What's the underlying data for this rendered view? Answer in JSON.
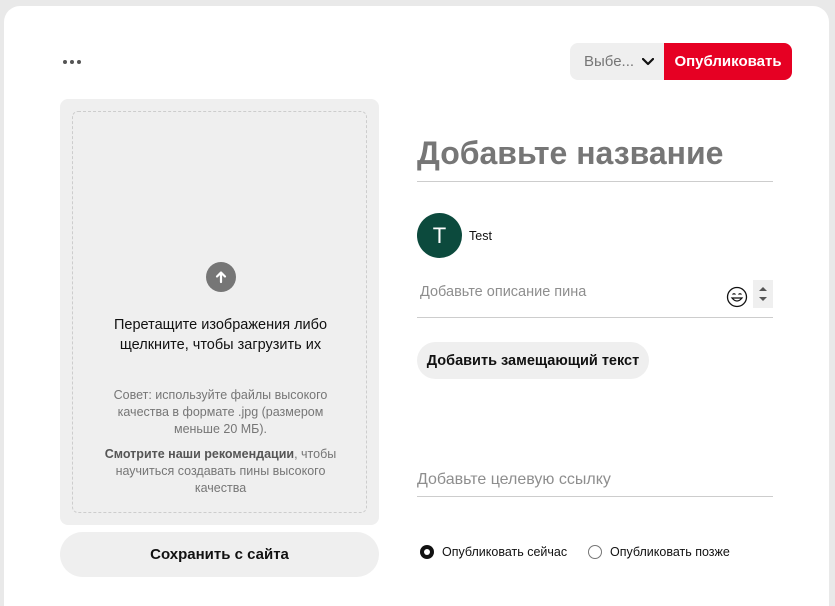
{
  "toolbar": {
    "board_select_label": "Выбе...",
    "publish_label": "Опубликовать"
  },
  "upload": {
    "title": "Перетащите изображения либо щелкните, чтобы загрузить их",
    "tip": "Совет: используйте файлы высокого качества в формате .jpg (размером меньше 20 МБ).",
    "reco_link": "Смотрите наши рекомендации",
    "reco_rest": ", чтобы научиться создавать пины высокого качества",
    "save_from_site_label": "Сохранить с сайта"
  },
  "pin": {
    "title_placeholder": "Добавьте название",
    "user": {
      "initial": "T",
      "name": "Test",
      "avatar_color": "#0c4a3d"
    },
    "description_placeholder": "Добавьте описание пина",
    "alt_text_button": "Добавить замещающий текст",
    "link_placeholder": "Добавьте целевую ссылку"
  },
  "publish_options": {
    "now_label": "Опубликовать сейчас",
    "later_label": "Опубликовать позже",
    "selected": "now"
  },
  "colors": {
    "brand_red": "#e60023",
    "surface_gray": "#efefef"
  }
}
